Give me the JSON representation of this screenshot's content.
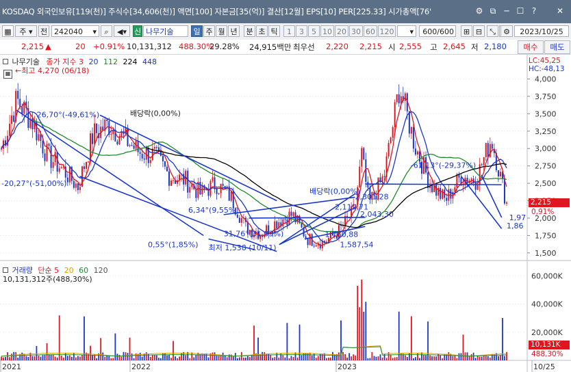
{
  "window": {
    "title": "KOSDAQ 외국인보유[119(천)] 주식수[34,606(천)] 액면[100] 자본금[35(억)] 결산[12월] EPS[10] PER[225.33] 시가총액[76'",
    "btn_settings": "⚙",
    "btn_restore": "⧉",
    "btn_minimize": "─",
    "btn_maximize": "☐",
    "btn_help": "?",
    "btn_close": "✕"
  },
  "toolbar": {
    "type_select": "주",
    "prefix_btn": "전",
    "code_value": "242040",
    "name_value": "나무기술",
    "periods": [
      "일",
      "주",
      "월",
      "년",
      "분",
      "초",
      "틱"
    ],
    "active_period": "일",
    "intervals": [
      "1",
      "3",
      "5",
      "10",
      "20",
      "30",
      "60",
      "120"
    ],
    "count_value": "600",
    "count_total": "/600",
    "date_value": "2023/10/25",
    "code_prefix": "신"
  },
  "quote": {
    "price": "2,215",
    "change": "20",
    "change_pct": "+0.91%",
    "volume": "10,131,312",
    "vol_ratio": "488.30%",
    "turnover": "29.28%",
    "amount": "24,915백만",
    "priority_label": "최우선",
    "bid": "2,220",
    "ask": "2,215",
    "open_label": "시",
    "open": "2,555",
    "high_label": "고",
    "high": "2,645",
    "low_label": "저",
    "low": "2,180",
    "buy_label": "매수",
    "sell_label": "매도"
  },
  "price_panel": {
    "stock_name": "나무기술",
    "ma_label": "종가 지수 3",
    "ma_periods": [
      "20",
      "112",
      "224",
      "448"
    ],
    "ma_colors": [
      "#e0161f",
      "#1a37c8",
      "#1f8b2a",
      "#000000",
      "#1a37c8"
    ],
    "high_marker": "최고 4,270 (06/18)",
    "lc": "LC:45,25",
    "hc": "HC:-48,13",
    "yticks": [
      "4,000",
      "3,750",
      "3,500",
      "3,250",
      "3,000",
      "2,750",
      "2,500",
      "2,250",
      "2,000",
      "1,750",
      "1,500"
    ],
    "current_price_tag": "2,215",
    "current_pct_tag": "0,91%",
    "dividend_label": "배당락(0,00%)",
    "annotations": [
      "26,70°(-49,61%)",
      "-20,27°(-51,00%)",
      "6,34°(9,55%)",
      "0,55°(1,85%)",
      "31,76°(31,93%)",
      "최저 1,538 (10/11)",
      "배당락(0,00%)",
      "2,301,28",
      "2,119,71",
      "2,043,30",
      "1,760,88",
      "1,587,54",
      "-61,13°(-29,37%)",
      "1,97",
      "1,86"
    ]
  },
  "volume_panel": {
    "label": "거래량",
    "ma_label": "단순 5",
    "ma_periods": [
      "20",
      "60",
      "120"
    ],
    "value": "10,131,312주(488,30%)",
    "yticks": [
      "60,000K",
      "40,000K",
      "20,000K"
    ],
    "current_tag": "10,131K",
    "current_pct_tag": "488,30%"
  },
  "x_axis": {
    "labels": [
      "2021",
      "2022",
      "2023",
      "10/25"
    ]
  },
  "chart_data": {
    "type": "line",
    "title": "나무기술",
    "xlabel": "",
    "ylabel": "",
    "ylim": [
      1400,
      4270
    ],
    "series": [
      {
        "name": "종가",
        "x": [
          "2021-01",
          "2021-02",
          "2021-03",
          "2021-04",
          "2021-05",
          "2021-06",
          "2021-07",
          "2021-08",
          "2021-09",
          "2021-10",
          "2021-11",
          "2021-12",
          "2022-01",
          "2022-02",
          "2022-03",
          "2022-04",
          "2022-05",
          "2022-06",
          "2022-07",
          "2022-08",
          "2022-09",
          "2022-10",
          "2022-11",
          "2022-12",
          "2023-01",
          "2023-02",
          "2023-03",
          "2023-04",
          "2023-05",
          "2023-06",
          "2023-07",
          "2023-08",
          "2023-09",
          "2023-10"
        ],
        "values": [
          3000,
          3700,
          3400,
          2900,
          2700,
          2450,
          3200,
          3350,
          3150,
          2950,
          2900,
          2600,
          2550,
          2350,
          2500,
          2300,
          1850,
          1780,
          1950,
          2050,
          1700,
          1650,
          1800,
          2100,
          2200,
          2600,
          3900,
          3050,
          2500,
          2250,
          2600,
          2550,
          3150,
          2215
        ]
      }
    ],
    "volume_ylim": [
      0,
      70000
    ],
    "volume_unit": "K"
  }
}
